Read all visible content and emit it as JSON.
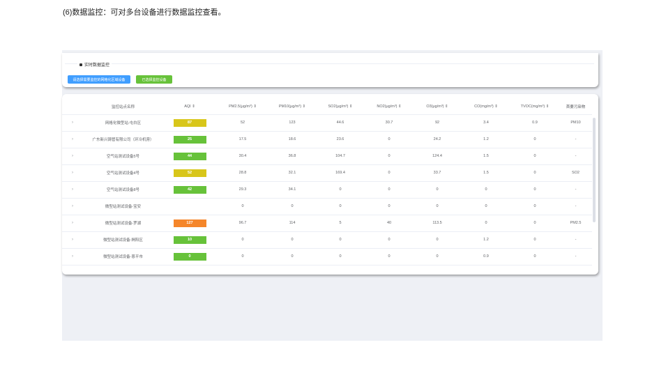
{
  "caption": "(6)数据监控：可对多台设备进行数据监控查看。",
  "section": {
    "title": "实时数据监控"
  },
  "buttons": {
    "select_devices": "请选择需要监控的网格化区域设备",
    "selected_devices": "已选择监控设备"
  },
  "colors": {
    "primary": "#409eff",
    "success": "#67c23a",
    "aqi_green": "#67c23a",
    "aqi_yellow": "#d8c61a",
    "aqi_orange": "#f5862a"
  },
  "table": {
    "headers": [
      "监控站点名称",
      "AQI ⇕",
      "PM2.5(μg/m³) ⇕",
      "PM10(μg/m³) ⇕",
      "SO2(μg/m³) ⇕",
      "NO2(μg/m³) ⇕",
      "O3(μg/m³) ⇕",
      "CO(mg/m³) ⇕",
      "TVOC(mg/m³) ⇕",
      "首要污染物"
    ],
    "expand_icon": "›",
    "rows": [
      {
        "name": "网格化微型站-屯白区",
        "aqi": "87",
        "aqi_color": "#d8c61a",
        "pm25": "52",
        "pm10": "123",
        "so2": "44.6",
        "no2": "30.7",
        "o3": "92",
        "co": "3.4",
        "tvoc": "0.9",
        "primary": "PM10"
      },
      {
        "name": "广东新兴铸管有限公司（环冷机旁）",
        "aqi": "25",
        "aqi_color": "#67c23a",
        "pm25": "17.5",
        "pm10": "18.6",
        "so2": "23.6",
        "no2": "0",
        "o3": "24.2",
        "co": "1.2",
        "tvoc": "0",
        "primary": "-"
      },
      {
        "name": "空气站测试设备5号",
        "aqi": "44",
        "aqi_color": "#67c23a",
        "pm25": "30.4",
        "pm10": "36.8",
        "so2": "104.7",
        "no2": "0",
        "o3": "124.4",
        "co": "1.5",
        "tvoc": "0",
        "primary": "-"
      },
      {
        "name": "空气站测试设备4号",
        "aqi": "52",
        "aqi_color": "#d8c61a",
        "pm25": "28.8",
        "pm10": "32.1",
        "so2": "169.4",
        "no2": "0",
        "o3": "33.7",
        "co": "1.5",
        "tvoc": "0",
        "primary": "SO2"
      },
      {
        "name": "空气站测试设备8号",
        "aqi": "42",
        "aqi_color": "#67c23a",
        "pm25": "29.3",
        "pm10": "34.1",
        "so2": "0",
        "no2": "0",
        "o3": "0",
        "co": "0",
        "tvoc": "0",
        "primary": "-"
      },
      {
        "name": "微型站测试设备-宝安",
        "aqi": "",
        "aqi_color": "",
        "pm25": "0",
        "pm10": "0",
        "so2": "0",
        "no2": "0",
        "o3": "0",
        "co": "0",
        "tvoc": "0",
        "primary": "-"
      },
      {
        "name": "微型站测试设备-罗湖",
        "aqi": "127",
        "aqi_color": "#f5862a",
        "pm25": "96.7",
        "pm10": "114",
        "so2": "5",
        "no2": "40",
        "o3": "113.5",
        "co": "0",
        "tvoc": "0",
        "primary": "PM2.5"
      },
      {
        "name": "微型站测试设备-揭阳区",
        "aqi": "10",
        "aqi_color": "#67c23a",
        "pm25": "0",
        "pm10": "0",
        "so2": "0",
        "no2": "0",
        "o3": "0",
        "co": "1.2",
        "tvoc": "0",
        "primary": "-"
      },
      {
        "name": "微型站测试设备-恩平市",
        "aqi": "0",
        "aqi_color": "#67c23a",
        "pm25": "0",
        "pm10": "0",
        "so2": "0",
        "no2": "0",
        "o3": "0",
        "co": "0.9",
        "tvoc": "0",
        "primary": "-"
      }
    ]
  }
}
